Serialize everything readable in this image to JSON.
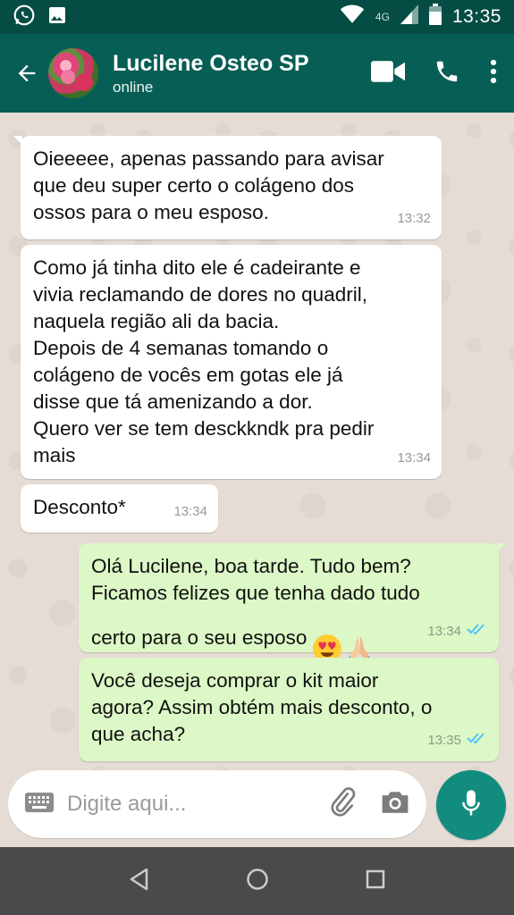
{
  "status_bar": {
    "time": "13:35",
    "network": "4G",
    "icons": [
      "whatsapp-icon",
      "image-icon",
      "wifi-icon",
      "signal-icon",
      "battery-icon"
    ]
  },
  "header": {
    "contact_name": "Lucilene Osteo SP",
    "contact_status": "online",
    "icons": [
      "back-arrow-icon",
      "videocam-icon",
      "phone-icon",
      "more-vert-icon"
    ]
  },
  "messages": [
    {
      "direction": "in",
      "text": "Oieeeee, apenas passando para avisar\nque deu super certo o colágeno dos\nossos para o meu esposo.",
      "time": "13:32"
    },
    {
      "direction": "in",
      "text": "Como já tinha dito ele é cadeirante e\nvivia reclamando de dores no quadril,\nnaquela região ali da bacia.\nDepois de 4 semanas tomando o\ncolágeno de vocês em gotas ele já\ndisse que tá amenizando a dor.\nQuero ver se tem desckkndk pra pedir\nmais",
      "time": "13:34"
    },
    {
      "direction": "in",
      "text": "Desconto*",
      "time": "13:34"
    },
    {
      "direction": "out",
      "text": "Olá Lucilene, boa tarde. Tudo bem?\nFicamos felizes que tenha dado tudo\ncerto para o seu esposo",
      "emojis": [
        "heart-eyes-emoji",
        "praying-hands-emoji"
      ],
      "time": "13:34",
      "read": true
    },
    {
      "direction": "out",
      "text": "Você deseja comprar o kit maior\nagora? Assim obtém mais desconto, o\nque acha?",
      "time": "13:35",
      "read": true
    }
  ],
  "composer": {
    "placeholder": "Digite aqui...",
    "value": "",
    "icons": [
      "keyboard-icon",
      "attach-icon",
      "camera-icon",
      "mic-icon"
    ]
  },
  "nav_bar": {
    "icons": [
      "back-triangle-icon",
      "home-circle-icon",
      "recents-square-icon"
    ]
  },
  "colors": {
    "header": "#075e54",
    "status_bar": "#054d44",
    "outgoing_bubble": "#dcf8c6",
    "incoming_bubble": "#ffffff",
    "chat_background": "#e5ddd5",
    "mic_button": "#128c7e",
    "read_ticks": "#4fc3f7"
  }
}
